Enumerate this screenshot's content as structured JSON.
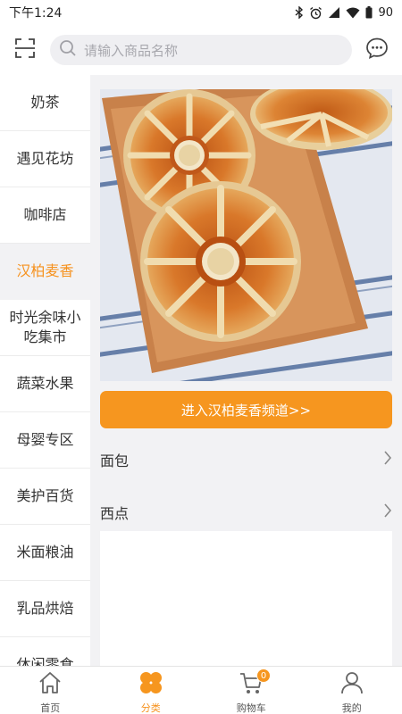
{
  "status_bar": {
    "time": "下午1:24",
    "battery": "90",
    "icons": [
      "bluetooth-icon",
      "alarm-icon",
      "signal-icon",
      "wifi-icon",
      "battery-icon"
    ]
  },
  "header": {
    "scan_icon": "scan-icon",
    "search_placeholder": "请输入商品名称",
    "message_icon": "message-icon"
  },
  "sidebar": {
    "active_index": 3,
    "items": [
      {
        "label": "奶茶"
      },
      {
        "label": "遇见花坊"
      },
      {
        "label": "咖啡店"
      },
      {
        "label": "汉柏麦香"
      },
      {
        "label": "时光余味小吃集市"
      },
      {
        "label": "蔬菜水果"
      },
      {
        "label": "母婴专区"
      },
      {
        "label": "美护百货"
      },
      {
        "label": "米面粮油"
      },
      {
        "label": "乳品烘焙"
      },
      {
        "label": "休闲零食"
      }
    ]
  },
  "content": {
    "channel_button": "进入汉柏麦香频道>>",
    "subcategories": [
      {
        "label": "面包"
      },
      {
        "label": "西点"
      }
    ]
  },
  "bottom_nav": {
    "active": "分类",
    "items": [
      {
        "label": "首页",
        "icon": "home-icon"
      },
      {
        "label": "分类",
        "icon": "category-icon"
      },
      {
        "label": "购物车",
        "icon": "cart-icon",
        "badge": "0"
      },
      {
        "label": "我的",
        "icon": "profile-icon"
      }
    ]
  },
  "colors": {
    "accent": "#f6961f",
    "background": "#f2f2f4"
  }
}
